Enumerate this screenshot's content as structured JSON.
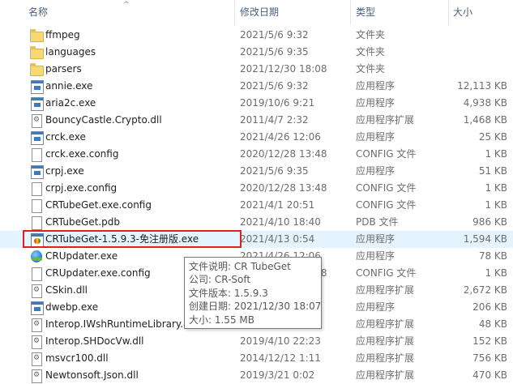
{
  "columns": {
    "name": "名称",
    "date": "修改日期",
    "type": "类型",
    "size": "大小"
  },
  "files": [
    {
      "icon": "folder-icon",
      "name": "ffmpeg",
      "date": "2021/5/6 9:32",
      "type": "文件夹",
      "size": ""
    },
    {
      "icon": "folder-icon",
      "name": "languages",
      "date": "2021/5/6 9:35",
      "type": "文件夹",
      "size": ""
    },
    {
      "icon": "folder-icon",
      "name": "parsers",
      "date": "2021/12/30 18:08",
      "type": "文件夹",
      "size": ""
    },
    {
      "icon": "exe-icon",
      "name": "annie.exe",
      "date": "2021/5/6 9:32",
      "type": "应用程序",
      "size": "12,113 KB"
    },
    {
      "icon": "exe-icon",
      "name": "aria2c.exe",
      "date": "2019/10/6 9:21",
      "type": "应用程序",
      "size": "4,938 KB"
    },
    {
      "icon": "dll-icon",
      "name": "BouncyCastle.Crypto.dll",
      "date": "2011/4/7 2:32",
      "type": "应用程序扩展",
      "size": "1,468 KB"
    },
    {
      "icon": "exe-icon",
      "name": "crck.exe",
      "date": "2021/4/26 12:06",
      "type": "应用程序",
      "size": "25 KB"
    },
    {
      "icon": "config-icon",
      "name": "crck.exe.config",
      "date": "2020/12/28 13:48",
      "type": "CONFIG 文件",
      "size": "1 KB"
    },
    {
      "icon": "exe-icon",
      "name": "crpj.exe",
      "date": "2021/5/6 9:35",
      "type": "应用程序",
      "size": "51 KB"
    },
    {
      "icon": "config-icon",
      "name": "crpj.exe.config",
      "date": "2020/12/28 13:48",
      "type": "CONFIG 文件",
      "size": "1 KB"
    },
    {
      "icon": "config-icon",
      "name": "CRTubeGet.exe.config",
      "date": "2021/4/1 20:51",
      "type": "CONFIG 文件",
      "size": "1 KB"
    },
    {
      "icon": "pdb-icon",
      "name": "CRTubeGet.pdb",
      "date": "2021/4/10 18:40",
      "type": "PDB 文件",
      "size": "986 KB"
    },
    {
      "icon": "crtubeget-app-icon",
      "name": "CRTubeGet-1.5.9.3-免注册版.exe",
      "date": "2021/4/13 0:54",
      "type": "应用程序",
      "size": "1,594 KB"
    },
    {
      "icon": "updater-globe-icon",
      "name": "CRUpdater.exe",
      "date": "2021/4/26 12:06",
      "type": "应用程序",
      "size": "78 KB"
    },
    {
      "icon": "config-icon",
      "name": "CRUpdater.exe.config",
      "date": "2020/12/28 13:48",
      "type": "CONFIG 文件",
      "size": "1 KB"
    },
    {
      "icon": "dll-icon",
      "name": "CSkin.dll",
      "date": "",
      "type": "应用程序扩展",
      "size": "2,672 KB"
    },
    {
      "icon": "exe-icon",
      "name": "dwebp.exe",
      "date": "",
      "type": "应用程序",
      "size": "206 KB"
    },
    {
      "icon": "dll-icon",
      "name": "Interop.IWshRuntimeLibrary.d",
      "date": "",
      "type": "应用程序扩展",
      "size": "48 KB"
    },
    {
      "icon": "dll-icon",
      "name": "Interop.SHDocVw.dll",
      "date": "2019/4/10 22:23",
      "type": "应用程序扩展",
      "size": "152 KB"
    },
    {
      "icon": "dll-icon",
      "name": "msvcr100.dll",
      "date": "2014/12/12 1:11",
      "type": "应用程序扩展",
      "size": "756 KB"
    },
    {
      "icon": "dll-icon",
      "name": "Newtonsoft.Json.dll",
      "date": "2019/3/21 0:02",
      "type": "应用程序扩展",
      "size": "470 KB"
    }
  ],
  "hovered_index": 12,
  "tooltip": {
    "description": "文件说明: CR TubeGet",
    "company": "公司: CR-Soft",
    "version": "文件版本: 1.5.9.3",
    "created": "创建日期: 2021/12/30 18:07",
    "size": "大小: 1.55 MB"
  },
  "colors": {
    "highlight_border": "#e02020",
    "hover_row": "#e5f3ff",
    "header_text": "#4c607a"
  }
}
